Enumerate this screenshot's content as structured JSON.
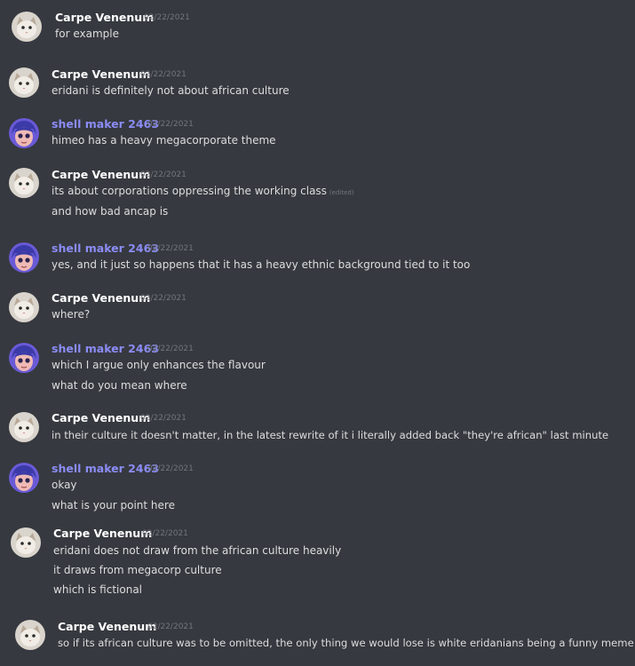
{
  "colors": {
    "background": "#36393f",
    "username_carpe": "#ffffff",
    "username_shell": "#8b8cf5",
    "text": "#dcddde",
    "timestamp": "#72767d"
  },
  "messages": [
    {
      "author": "Carpe Venenum",
      "timestamp": "02/22/2021",
      "avatar": "cat-avatar",
      "lines": [
        "for example"
      ]
    },
    {
      "author": "Carpe Venenum",
      "timestamp": "02/22/2021",
      "avatar": "cat-avatar",
      "lines": [
        "eridani is definitely not about african culture"
      ]
    },
    {
      "author": "shell maker 2463",
      "timestamp": "02/22/2021",
      "avatar": "anime-avatar",
      "lines": [
        "himeo has a heavy megacorporate theme"
      ]
    },
    {
      "author": "Carpe Venenum",
      "timestamp": "02/22/2021",
      "avatar": "cat-avatar",
      "lines": [
        "its about corporations oppressing the working class",
        "and how bad ancap is"
      ],
      "edited_label": "(edited)"
    },
    {
      "author": "shell maker 2463",
      "timestamp": "02/22/2021",
      "avatar": "anime-avatar",
      "lines": [
        "yes, and it just so happens that it has a heavy ethnic background tied to it too"
      ]
    },
    {
      "author": "Carpe Venenum",
      "timestamp": "02/22/2021",
      "avatar": "cat-avatar",
      "lines": [
        "where?"
      ]
    },
    {
      "author": "shell maker 2463",
      "timestamp": "02/22/2021",
      "avatar": "anime-avatar",
      "lines": [
        "which I argue only enhances the flavour",
        "what do you mean where"
      ]
    },
    {
      "author": "Carpe Venenum",
      "timestamp": "02/22/2021",
      "avatar": "cat-avatar",
      "lines": [
        "in their culture it doesn't matter, in the latest rewrite of it i literally added back \"they're african\" last minute"
      ]
    },
    {
      "author": "shell maker 2463",
      "timestamp": "02/22/2021",
      "avatar": "anime-avatar",
      "lines": [
        "okay",
        "what is your point here"
      ]
    },
    {
      "author": "Carpe Venenum",
      "timestamp": "02/22/2021",
      "avatar": "cat-avatar",
      "lines": [
        "eridani does not draw from the african culture heavily",
        "it draws from megacorp culture",
        "which is fictional"
      ]
    },
    {
      "author": "Carpe Venenum",
      "timestamp": "02/22/2021",
      "avatar": "cat-avatar",
      "lines": [
        "so if its african culture was to be omitted, the only thing we would lose is white eridanians being a funny meme"
      ]
    }
  ]
}
